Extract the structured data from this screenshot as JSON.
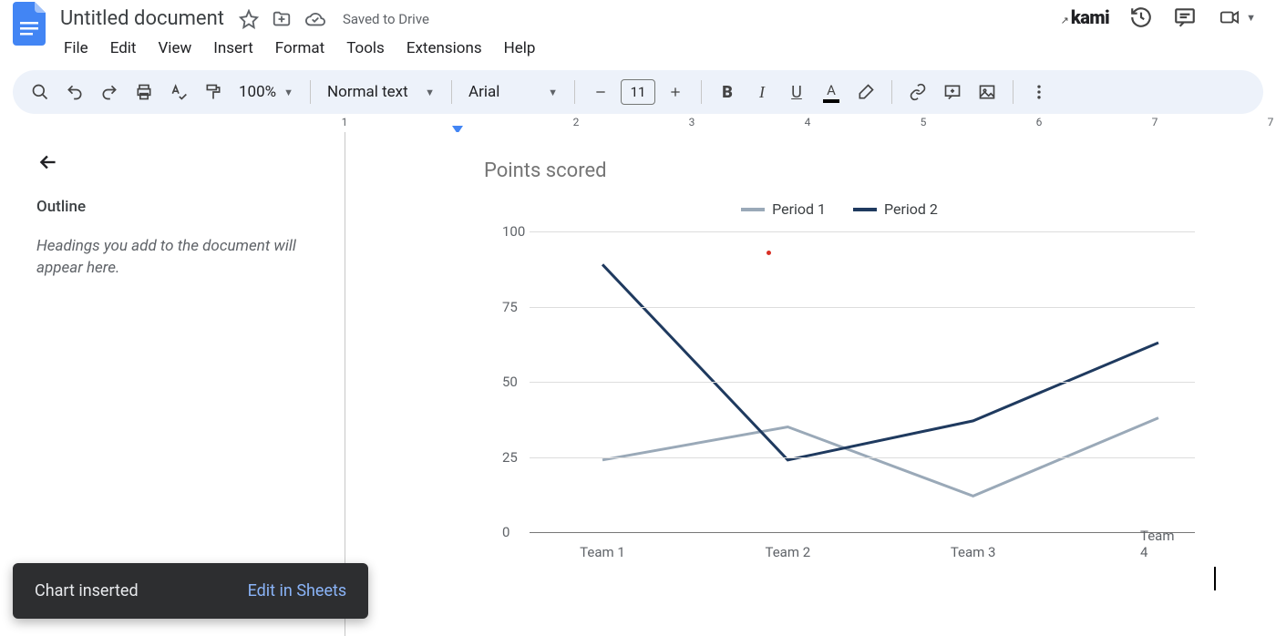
{
  "header": {
    "doc_title": "Untitled document",
    "saved_text": "Saved to Drive",
    "kami_label": "kami",
    "menus": [
      "File",
      "Edit",
      "View",
      "Insert",
      "Format",
      "Tools",
      "Extensions",
      "Help"
    ]
  },
  "toolbar": {
    "zoom": "100%",
    "style": "Normal text",
    "font": "Arial",
    "font_size": "11"
  },
  "ruler": {
    "numbers": [
      1,
      2,
      3,
      4,
      5,
      6,
      7
    ]
  },
  "sidebar": {
    "outline_title": "Outline",
    "outline_hint": "Headings you add to the document will appear here."
  },
  "toast": {
    "message": "Chart inserted",
    "action": "Edit in Sheets"
  },
  "chart_data": {
    "type": "line",
    "title": "Points scored",
    "categories": [
      "Team 1",
      "Team 2",
      "Team 3",
      "Team 4"
    ],
    "series": [
      {
        "name": "Period 1",
        "color": "#9aa9b8",
        "values": [
          24,
          35,
          12,
          38
        ]
      },
      {
        "name": "Period 2",
        "color": "#1f3a5f",
        "values": [
          89,
          24,
          37,
          63
        ]
      }
    ],
    "ylabel": "",
    "xlabel": "",
    "ylim": [
      0,
      100
    ],
    "yticks": [
      0,
      25,
      50,
      75,
      100
    ]
  }
}
